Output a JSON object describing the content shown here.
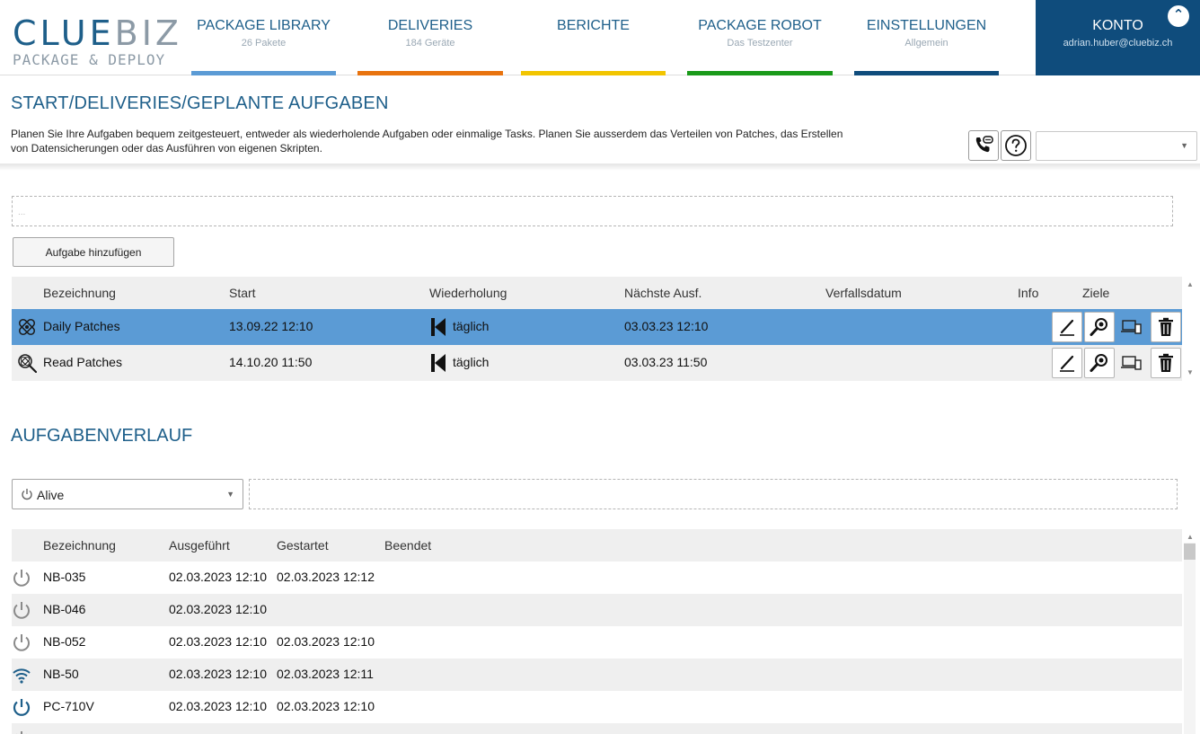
{
  "colors": {
    "brand_blue": "#1e5f8a",
    "account_bg": "#0f4c7c",
    "selected_row": "#5b9bd5",
    "tab_library": "#5b9bd5",
    "tab_deliveries": "#e8730e",
    "tab_berichte": "#f2c500",
    "tab_robot": "#1a9a1a",
    "tab_einstellungen": "#0f4c7c"
  },
  "logo": {
    "main": "CLUE",
    "accent": "BIZ",
    "sub": "PACKAGE & DEPLOY"
  },
  "nav": [
    {
      "title": "PACKAGE LIBRARY",
      "sub": "26 Pakete"
    },
    {
      "title": "DELIVERIES",
      "sub": "184 Geräte"
    },
    {
      "title": "BERICHTE",
      "sub": ""
    },
    {
      "title": "PACKAGE ROBOT",
      "sub": "Das Testzenter"
    },
    {
      "title": "EINSTELLUNGEN",
      "sub": "Allgemein"
    }
  ],
  "account": {
    "title": "KONTO",
    "email": "adrian.huber@cluebiz.ch",
    "collapse_icon": "double-chevron-up-icon"
  },
  "page": {
    "breadcrumb": "START/DELIVERIES/GEPLANTE AUFGABEN",
    "description": "Planen Sie Ihre Aufgaben bequem zeitgesteuert, entweder als wiederholende Aufgaben oder einmalige Tasks. Planen Sie ausserdem das Verteilen von Patches, das Erstellen von Datensicherungen oder das Ausführen von eigenen Skripten.",
    "select_value": ""
  },
  "filter": {
    "placeholder": "..."
  },
  "add_button": "Aufgabe hinzufügen",
  "tasks": {
    "columns": [
      "Bezeichnung",
      "Start",
      "Wiederholung",
      "Nächste Ausf.",
      "Verfallsdatum",
      "Info",
      "Ziele"
    ],
    "rows": [
      {
        "name": "Daily Patches",
        "start": "13.09.22 12:10",
        "repeat": "täglich",
        "next": "03.03.23 12:10",
        "expires": "",
        "info": "",
        "icon": "patch-bandage-icon",
        "selected": true
      },
      {
        "name": "Read Patches",
        "start": "14.10.20 11:50",
        "repeat": "täglich",
        "next": "03.03.23 11:50",
        "expires": "",
        "info": "",
        "icon": "patch-search-icon",
        "selected": false
      }
    ]
  },
  "history": {
    "title": "AUFGABENVERLAUF",
    "status_filter": "Alive",
    "columns": [
      "Bezeichnung",
      "Ausgeführt",
      "Gestartet",
      "Beendet"
    ],
    "rows": [
      {
        "name": "NB-035",
        "executed": "02.03.2023 12:10",
        "started": "02.03.2023 12:12",
        "ended": "",
        "status": "power-off"
      },
      {
        "name": "NB-046",
        "executed": "02.03.2023 12:10",
        "started": "",
        "ended": "",
        "status": "power-off"
      },
      {
        "name": "NB-052",
        "executed": "02.03.2023 12:10",
        "started": "02.03.2023 12:10",
        "ended": "",
        "status": "power-off"
      },
      {
        "name": "NB-50",
        "executed": "02.03.2023 12:10",
        "started": "02.03.2023 12:11",
        "ended": "",
        "status": "wifi"
      },
      {
        "name": "PC-710V",
        "executed": "02.03.2023 12:10",
        "started": "02.03.2023 12:10",
        "ended": "",
        "status": "power-on"
      }
    ]
  }
}
